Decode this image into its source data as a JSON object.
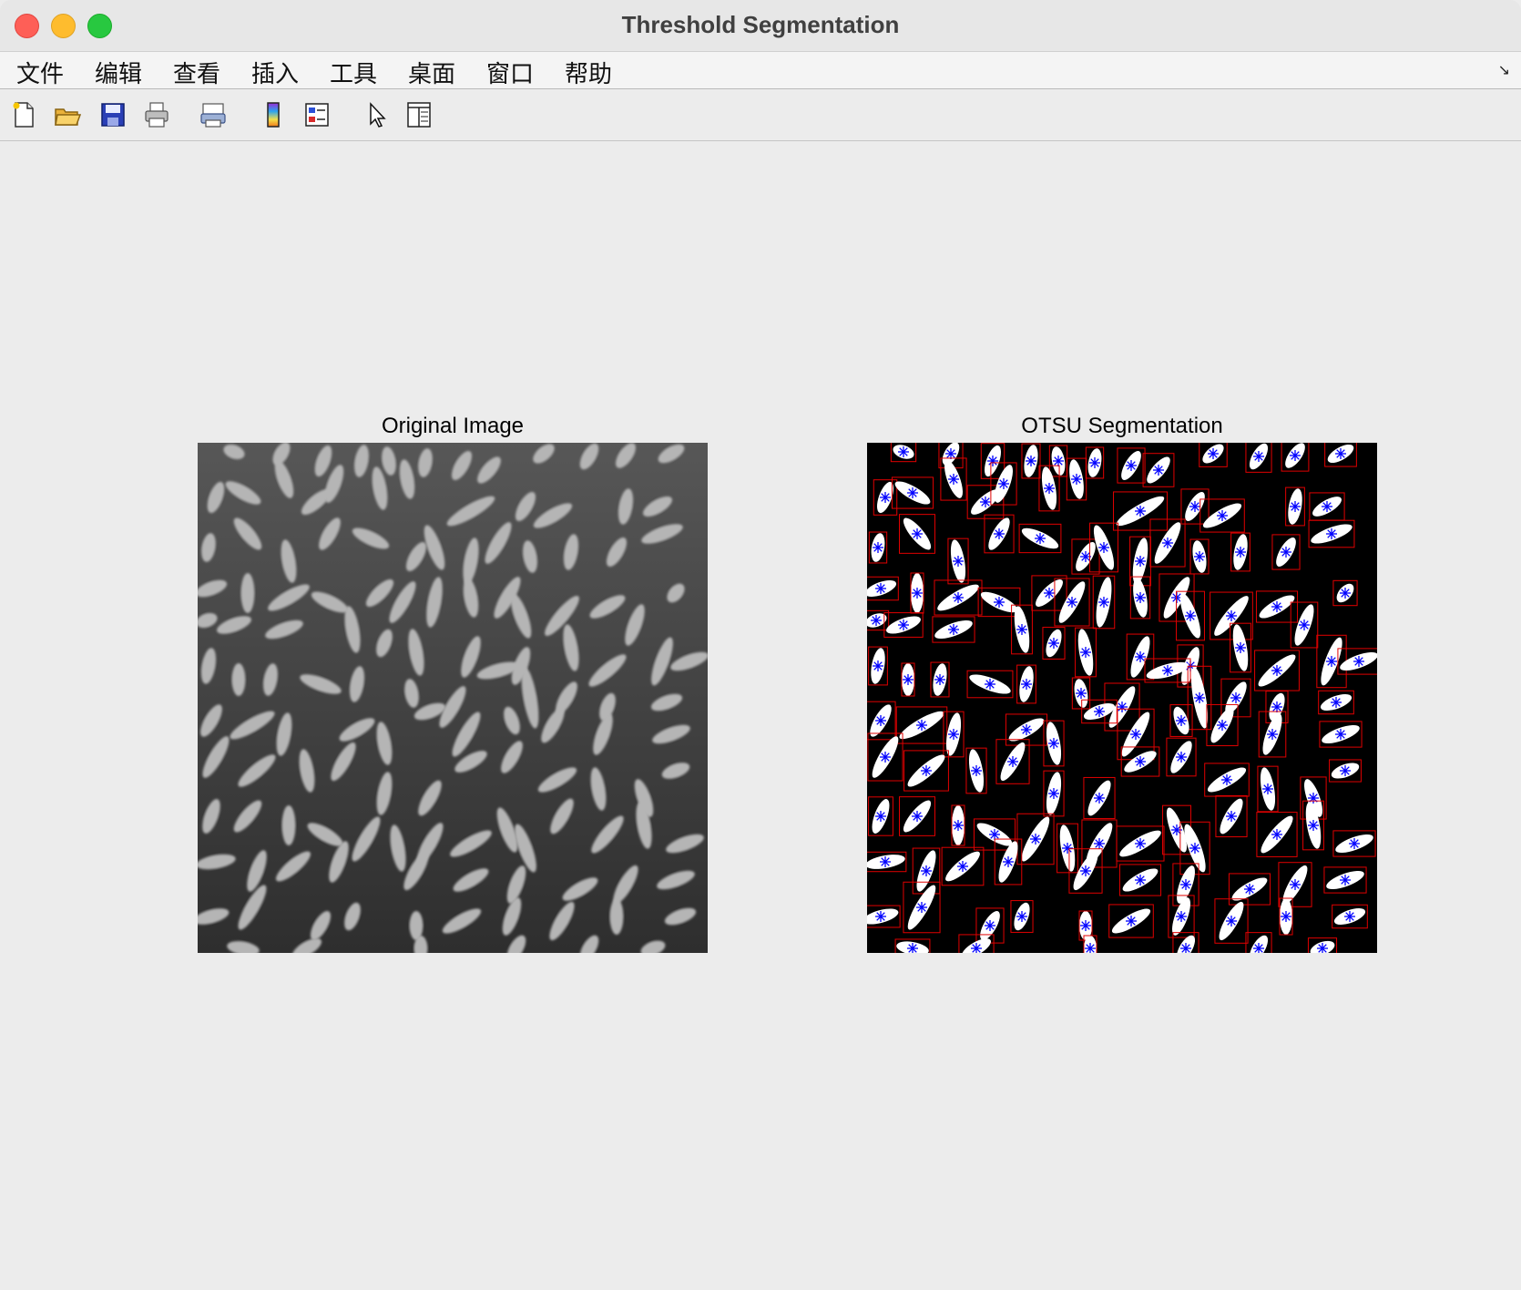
{
  "window": {
    "title": "Threshold Segmentation"
  },
  "menubar": {
    "items": [
      {
        "label": "文件"
      },
      {
        "label": "编辑"
      },
      {
        "label": "查看"
      },
      {
        "label": "插入"
      },
      {
        "label": "工具"
      },
      {
        "label": "桌面"
      },
      {
        "label": "窗口"
      },
      {
        "label": "帮助"
      }
    ]
  },
  "toolbar": {
    "icons": [
      "new-figure-icon",
      "open-file-icon",
      "save-icon",
      "print-icon",
      "print-preview-icon",
      "insert-colorbar-icon",
      "insert-legend-icon",
      "edit-plot-cursor-icon",
      "property-editor-icon"
    ]
  },
  "figure": {
    "left_axes": {
      "title": "Original Image"
    },
    "right_axes": {
      "title": "OTSU Segmentation"
    }
  },
  "colors": {
    "bbox_stroke": "#e00000",
    "centroid_marker": "#0000ff",
    "grain_original": "#b5b5b5",
    "background_original": "#4a4a4a"
  }
}
